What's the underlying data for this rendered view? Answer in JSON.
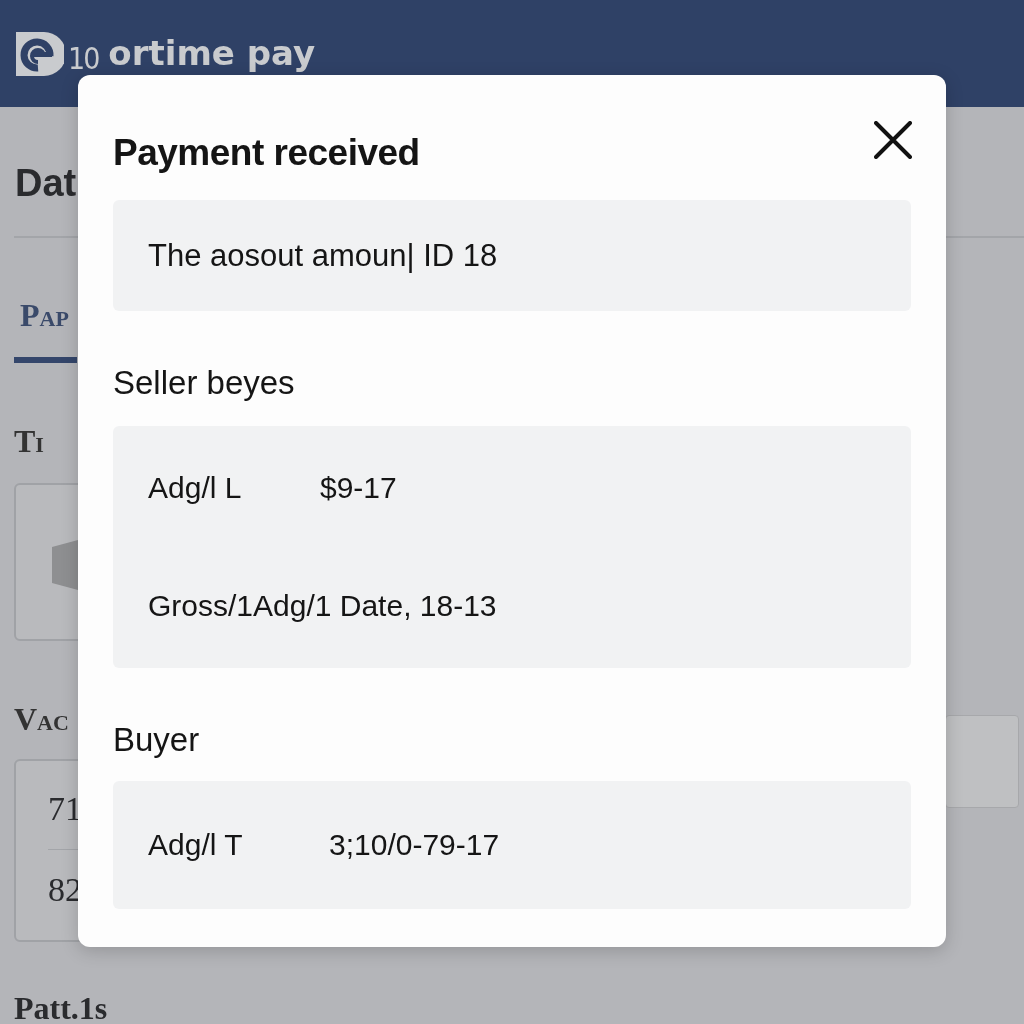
{
  "header": {
    "logo_number": "10",
    "logo_text": "ortime pay"
  },
  "page": {
    "title": "Dat",
    "tabs": [
      {
        "label": "Pap",
        "selected": true
      }
    ],
    "section_1": "Ti",
    "section_2": "Vac",
    "values": [
      "71",
      "82"
    ],
    "footer_label": "Patt.1s"
  },
  "modal": {
    "title": "Payment received",
    "summary": "The aosout amoun| ID 18",
    "sections": [
      {
        "heading": "Seller beyes",
        "rows": [
          {
            "kind": "pair",
            "label": "Adg/l L",
            "value": "$9-17"
          },
          {
            "kind": "line",
            "text": "Gross/1Adg/1 Date, 18-13"
          }
        ]
      },
      {
        "heading": "Buyer",
        "rows": [
          {
            "kind": "pair",
            "label": "Adg/l T",
            "value": "3;10/0-79-17"
          }
        ]
      }
    ]
  }
}
